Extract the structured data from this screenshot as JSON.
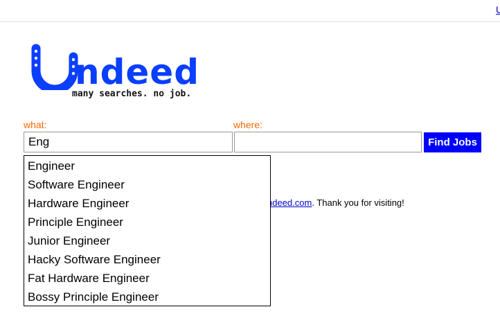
{
  "header": {
    "top_link": "U"
  },
  "logo": {
    "brand_rest": "ndeed",
    "tagline": "many searches. no job.",
    "color": "#0a3fff"
  },
  "search": {
    "what_label": "what:",
    "where_label": "where:",
    "what_value": "Eng",
    "where_value": "",
    "button_label": "Find Jobs",
    "button_color": "#0000ff",
    "label_color": "#ff6600"
  },
  "suggestions": [
    "Engineer",
    "Software Engineer",
    "Hardware Engineer",
    "Principle Engineer",
    "Junior Engineer",
    "Hacky Software Engineer",
    "Fat Hardware Engineer",
    "Bossy Principle Engineer"
  ],
  "footer_message": {
    "link_text": "ndeed.com",
    "suffix": ". Thank you for visiting!"
  }
}
